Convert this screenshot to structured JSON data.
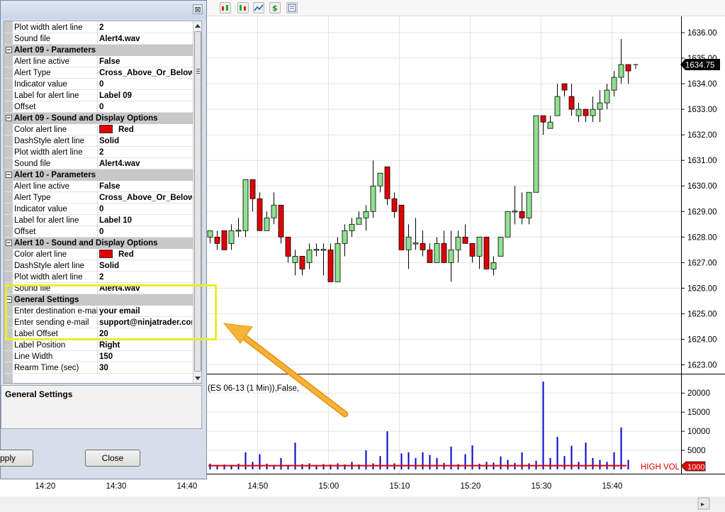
{
  "toolbar": {
    "icons": [
      "indicators-icon",
      "strategies-icon",
      "chart-style-icon",
      "price-icon",
      "properties-icon"
    ]
  },
  "dialog": {
    "close_glyph": "⊠",
    "rows": [
      {
        "type": "prop",
        "label": "Plot width alert line",
        "value": "2"
      },
      {
        "type": "prop",
        "label": "Sound file",
        "value": "Alert4.wav"
      },
      {
        "type": "cat",
        "label": "Alert 09 - Parameters"
      },
      {
        "type": "prop",
        "label": "Alert line active",
        "value": "False"
      },
      {
        "type": "prop",
        "label": "Alert Type",
        "value": "Cross_Above_Or_Below"
      },
      {
        "type": "prop",
        "label": "Indicator value",
        "value": "0"
      },
      {
        "type": "prop",
        "label": "Label for alert line",
        "value": "Label 09"
      },
      {
        "type": "prop",
        "label": "Offset",
        "value": "0"
      },
      {
        "type": "cat",
        "label": "Alert 09 - Sound and Display Options"
      },
      {
        "type": "prop",
        "label": "Color alert line",
        "value": "Red",
        "swatch": "#e00000"
      },
      {
        "type": "prop",
        "label": "DashStyle alert line",
        "value": "Solid"
      },
      {
        "type": "prop",
        "label": "Plot width alert line",
        "value": "2"
      },
      {
        "type": "prop",
        "label": "Sound file",
        "value": "Alert4.wav"
      },
      {
        "type": "cat",
        "label": "Alert 10 - Parameters"
      },
      {
        "type": "prop",
        "label": "Alert line active",
        "value": "False"
      },
      {
        "type": "prop",
        "label": "Alert Type",
        "value": "Cross_Above_Or_Below"
      },
      {
        "type": "prop",
        "label": "Indicator value",
        "value": "0"
      },
      {
        "type": "prop",
        "label": "Label for alert line",
        "value": "Label 10"
      },
      {
        "type": "prop",
        "label": "Offset",
        "value": "0"
      },
      {
        "type": "cat",
        "label": "Alert 10 - Sound and Display Options"
      },
      {
        "type": "prop",
        "label": "Color alert line",
        "value": "Red",
        "swatch": "#e00000"
      },
      {
        "type": "prop",
        "label": "DashStyle alert line",
        "value": "Solid"
      },
      {
        "type": "prop",
        "label": "Plot width alert line",
        "value": "2"
      },
      {
        "type": "prop",
        "label": "Sound file",
        "value": "Alert4.wav"
      },
      {
        "type": "cat",
        "label": "General Settings"
      },
      {
        "type": "prop",
        "label": "Enter destination e-mail",
        "value": "your email"
      },
      {
        "type": "prop",
        "label": "Enter sending e-mail",
        "value": "support@ninjatrader.com"
      },
      {
        "type": "prop",
        "label": "Label Offset",
        "value": "20"
      },
      {
        "type": "prop",
        "label": "Label Position",
        "value": "Right"
      },
      {
        "type": "prop",
        "label": "Line Width",
        "value": "150"
      },
      {
        "type": "prop",
        "label": "Rearm Time (sec)",
        "value": "30"
      }
    ],
    "description_title": "General Settings",
    "apply_label": "pply",
    "close_label": "Close"
  },
  "chart": {
    "last_price_label": "1634.75",
    "volume_indicator_label": "(ES 06-13 (1 Min)),False,",
    "high_vol_label": "HIGH VOL",
    "high_vol_threshold_label": "1000",
    "colors": {
      "up": "#90e090",
      "down": "#e00000",
      "volume": "#0000cc",
      "threshold": "#e00000",
      "highlight": "#ecec2a",
      "arrow": "#f5a623"
    }
  },
  "chart_data": [
    {
      "type": "candlestick",
      "title": "",
      "ylim": [
        1622.8,
        1636.4
      ],
      "y_ticks": [
        "1623.00",
        "1624.00",
        "1625.00",
        "1626.00",
        "1627.00",
        "1628.00",
        "1629.00",
        "1630.00",
        "1631.00",
        "1632.00",
        "1633.00",
        "1634.00",
        "1635.00",
        "1636.00"
      ],
      "x_ticks": [
        "14:20",
        "14:30",
        "14:40",
        "14:50",
        "15:00",
        "15:10",
        "15:20",
        "15:30",
        "15:40"
      ],
      "candles": [
        {
          "o": 1628.0,
          "h": 1628.25,
          "l": 1627.75,
          "c": 1628.25
        },
        {
          "o": 1628.0,
          "h": 1628.25,
          "l": 1627.5,
          "c": 1627.75
        },
        {
          "o": 1628.25,
          "h": 1628.25,
          "l": 1627.5,
          "c": 1627.5
        },
        {
          "o": 1627.75,
          "h": 1628.5,
          "l": 1627.5,
          "c": 1628.25
        },
        {
          "o": 1628.25,
          "h": 1628.75,
          "l": 1628.0,
          "c": 1628.25
        },
        {
          "o": 1628.25,
          "h": 1630.25,
          "l": 1628.0,
          "c": 1630.25
        },
        {
          "o": 1630.25,
          "h": 1630.25,
          "l": 1629.0,
          "c": 1629.5
        },
        {
          "o": 1629.5,
          "h": 1629.75,
          "l": 1628.25,
          "c": 1628.25
        },
        {
          "o": 1628.25,
          "h": 1629.0,
          "l": 1628.25,
          "c": 1628.75
        },
        {
          "o": 1628.75,
          "h": 1629.75,
          "l": 1628.5,
          "c": 1629.25
        },
        {
          "o": 1629.25,
          "h": 1629.25,
          "l": 1627.75,
          "c": 1628.0
        },
        {
          "o": 1628.0,
          "h": 1628.0,
          "l": 1627.0,
          "c": 1627.25
        },
        {
          "o": 1627.0,
          "h": 1627.5,
          "l": 1626.5,
          "c": 1627.25
        },
        {
          "o": 1627.25,
          "h": 1627.25,
          "l": 1626.5,
          "c": 1626.75
        },
        {
          "o": 1627.0,
          "h": 1627.75,
          "l": 1626.75,
          "c": 1627.5
        },
        {
          "o": 1627.5,
          "h": 1627.75,
          "l": 1627.25,
          "c": 1627.5
        },
        {
          "o": 1627.5,
          "h": 1627.75,
          "l": 1626.5,
          "c": 1627.5
        },
        {
          "o": 1627.5,
          "h": 1627.75,
          "l": 1626.25,
          "c": 1626.25
        },
        {
          "o": 1626.25,
          "h": 1628.0,
          "l": 1626.25,
          "c": 1627.75
        },
        {
          "o": 1627.75,
          "h": 1628.5,
          "l": 1627.25,
          "c": 1628.25
        },
        {
          "o": 1628.25,
          "h": 1628.75,
          "l": 1628.0,
          "c": 1628.5
        },
        {
          "o": 1628.5,
          "h": 1629.0,
          "l": 1628.5,
          "c": 1628.75
        },
        {
          "o": 1628.75,
          "h": 1629.25,
          "l": 1628.25,
          "c": 1629.0
        },
        {
          "o": 1629.0,
          "h": 1631.0,
          "l": 1628.75,
          "c": 1630.0
        },
        {
          "o": 1630.0,
          "h": 1630.5,
          "l": 1629.75,
          "c": 1630.5
        },
        {
          "o": 1630.75,
          "h": 1630.75,
          "l": 1629.25,
          "c": 1629.5
        },
        {
          "o": 1629.5,
          "h": 1629.75,
          "l": 1628.75,
          "c": 1629.0
        },
        {
          "o": 1629.25,
          "h": 1629.25,
          "l": 1627.5,
          "c": 1627.5
        },
        {
          "o": 1627.5,
          "h": 1628.5,
          "l": 1626.75,
          "c": 1628.0
        },
        {
          "o": 1627.75,
          "h": 1628.75,
          "l": 1627.5,
          "c": 1627.75
        },
        {
          "o": 1627.75,
          "h": 1628.25,
          "l": 1627.25,
          "c": 1627.5
        },
        {
          "o": 1627.5,
          "h": 1627.75,
          "l": 1627.0,
          "c": 1627.0
        },
        {
          "o": 1627.0,
          "h": 1628.0,
          "l": 1627.0,
          "c": 1627.75
        },
        {
          "o": 1627.75,
          "h": 1628.25,
          "l": 1627.0,
          "c": 1627.0
        },
        {
          "o": 1627.0,
          "h": 1628.25,
          "l": 1626.25,
          "c": 1627.5
        },
        {
          "o": 1627.5,
          "h": 1628.25,
          "l": 1627.0,
          "c": 1628.0
        },
        {
          "o": 1628.0,
          "h": 1628.5,
          "l": 1627.75,
          "c": 1627.75
        },
        {
          "o": 1627.75,
          "h": 1627.75,
          "l": 1627.0,
          "c": 1627.25
        },
        {
          "o": 1627.25,
          "h": 1628.0,
          "l": 1626.75,
          "c": 1628.0
        },
        {
          "o": 1628.0,
          "h": 1628.0,
          "l": 1626.75,
          "c": 1626.75
        },
        {
          "o": 1626.75,
          "h": 1627.25,
          "l": 1626.5,
          "c": 1627.0
        },
        {
          "o": 1627.25,
          "h": 1628.0,
          "l": 1627.25,
          "c": 1628.0
        },
        {
          "o": 1628.0,
          "h": 1629.0,
          "l": 1628.0,
          "c": 1629.0
        },
        {
          "o": 1629.0,
          "h": 1630.0,
          "l": 1628.5,
          "c": 1629.0
        },
        {
          "o": 1629.0,
          "h": 1629.75,
          "l": 1628.5,
          "c": 1628.75
        },
        {
          "o": 1628.75,
          "h": 1629.75,
          "l": 1628.5,
          "c": 1629.75
        },
        {
          "o": 1629.75,
          "h": 1632.75,
          "l": 1629.75,
          "c": 1632.75
        },
        {
          "o": 1632.75,
          "h": 1632.75,
          "l": 1632.0,
          "c": 1632.5
        },
        {
          "o": 1632.25,
          "h": 1632.75,
          "l": 1632.25,
          "c": 1632.5
        },
        {
          "o": 1632.75,
          "h": 1634.0,
          "l": 1632.75,
          "c": 1633.5
        },
        {
          "o": 1634.0,
          "h": 1634.0,
          "l": 1633.5,
          "c": 1633.75
        },
        {
          "o": 1633.5,
          "h": 1634.0,
          "l": 1632.75,
          "c": 1633.0
        },
        {
          "o": 1632.75,
          "h": 1633.25,
          "l": 1632.5,
          "c": 1633.0
        },
        {
          "o": 1633.0,
          "h": 1633.0,
          "l": 1632.5,
          "c": 1632.75
        },
        {
          "o": 1632.75,
          "h": 1633.5,
          "l": 1632.5,
          "c": 1633.0
        },
        {
          "o": 1633.0,
          "h": 1633.75,
          "l": 1632.5,
          "c": 1633.25
        },
        {
          "o": 1633.25,
          "h": 1634.0,
          "l": 1633.0,
          "c": 1633.75
        },
        {
          "o": 1633.75,
          "h": 1634.5,
          "l": 1633.5,
          "c": 1634.25
        },
        {
          "o": 1634.25,
          "h": 1635.75,
          "l": 1634.0,
          "c": 1634.75
        },
        {
          "o": 1634.75,
          "h": 1634.75,
          "l": 1634.0,
          "c": 1634.5
        }
      ]
    },
    {
      "type": "bar",
      "title": "",
      "ylim": [
        0,
        24500
      ],
      "y_ticks": [
        "5000",
        "10000",
        "15000",
        "20000"
      ],
      "threshold": 1000,
      "values": [
        1500,
        1200,
        1300,
        1200,
        1500,
        4500,
        2000,
        4000,
        1500,
        1200,
        3000,
        1200,
        7000,
        1400,
        1600,
        1200,
        1400,
        1300,
        1600,
        1300,
        2000,
        1300,
        5000,
        1600,
        3500,
        10000,
        1600,
        4200,
        4500,
        3000,
        4500,
        3800,
        3000,
        1700,
        6000,
        1400,
        4000,
        6300,
        1500,
        2000,
        1800,
        3400,
        2500,
        1700,
        4500,
        1600,
        2300,
        23000,
        3000,
        8500,
        3500,
        6200,
        2000,
        7000,
        3000,
        2500,
        2000,
        4500,
        11000,
        2500
      ]
    }
  ]
}
